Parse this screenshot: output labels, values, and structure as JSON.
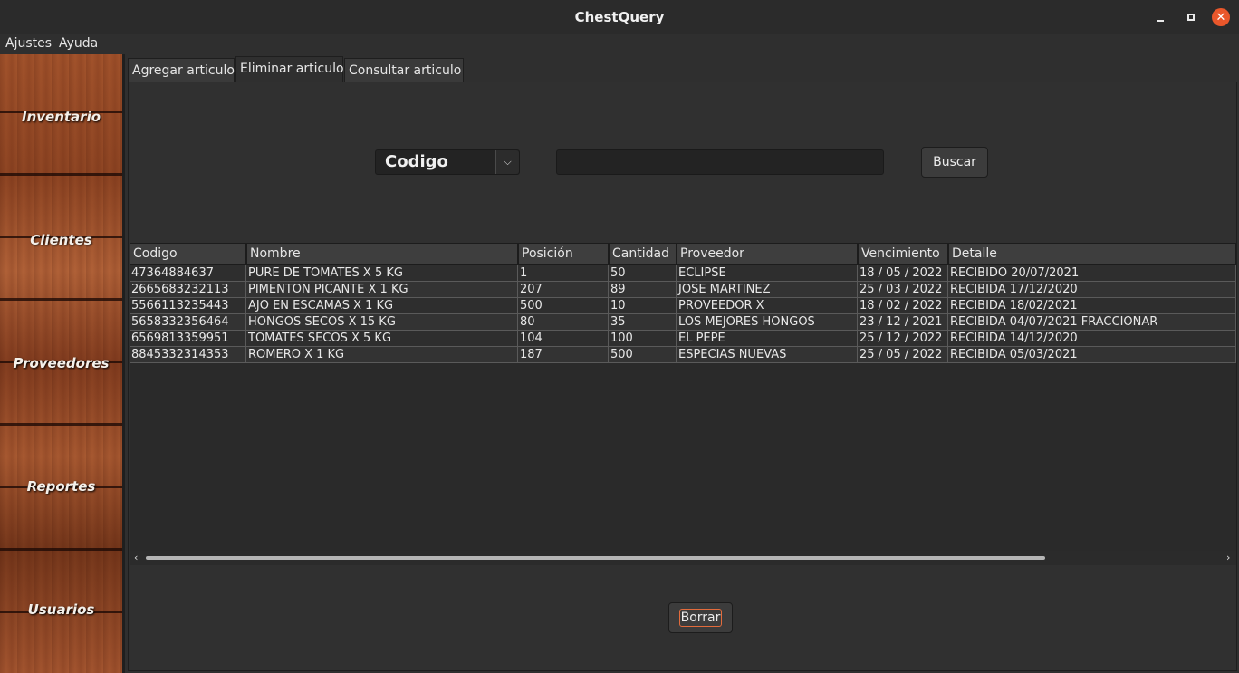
{
  "window": {
    "title": "ChestQuery"
  },
  "menu": [
    "Ajustes",
    "Ayuda"
  ],
  "sidebar": {
    "items": [
      {
        "label": "Inventario"
      },
      {
        "label": "Clientes"
      },
      {
        "label": "Proveedores"
      },
      {
        "label": "Reportes"
      },
      {
        "label": "Usuarios"
      }
    ]
  },
  "tabs": [
    {
      "label": "Agregar articulo"
    },
    {
      "label": "Eliminar articulo",
      "active": true
    },
    {
      "label": "Consultar articulo"
    }
  ],
  "search": {
    "field_selected": "Codigo",
    "value": "",
    "button_label": "Buscar"
  },
  "table": {
    "columns": [
      "Codigo",
      "Nombre",
      "Posición",
      "Cantidad",
      "Proveedor",
      "Vencimiento",
      "Detalle"
    ],
    "rows": [
      [
        "47364884637",
        "PURE DE TOMATES X 5 KG",
        "1",
        "50",
        "ECLIPSE",
        "18 / 05 / 2022",
        "RECIBIDO 20/07/2021"
      ],
      [
        "2665683232113",
        "PIMENTON PICANTE X 1 KG",
        "207",
        "89",
        "JOSE MARTINEZ",
        "25 / 03 / 2022",
        "RECIBIDA 17/12/2020"
      ],
      [
        "5566113235443",
        "AJO EN ESCAMAS X 1 KG",
        "500",
        "10",
        "PROVEEDOR X",
        "18 / 02 / 2022",
        "RECIBIDA 18/02/2021"
      ],
      [
        "5658332356464",
        "HONGOS SECOS X 15 KG",
        "80",
        "35",
        "LOS MEJORES HONGOS",
        "23 / 12 / 2021",
        "RECIBIDA 04/07/2021 FRACCIONAR"
      ],
      [
        "6569813359951",
        "TOMATES SECOS X 5 KG",
        "104",
        "100",
        "EL PEPE",
        "25 / 12 / 2022",
        "RECIBIDA 14/12/2020"
      ],
      [
        "8845332314353",
        "ROMERO X 1 KG",
        "187",
        "500",
        "ESPECIAS NUEVAS",
        "25 / 05 / 2022",
        "RECIBIDA 05/03/2021"
      ]
    ]
  },
  "actions": {
    "delete_label": "Borrar"
  },
  "colors": {
    "close_button": "#e9572b",
    "focus_ring": "#e36b3c"
  }
}
